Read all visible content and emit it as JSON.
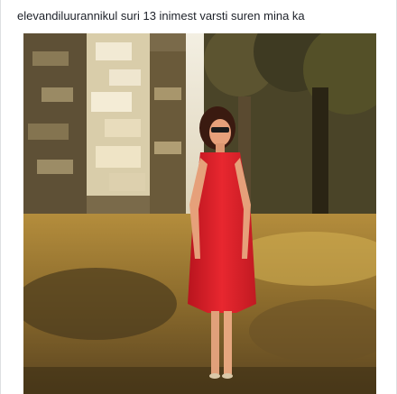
{
  "post": {
    "caption": "elevandiluurannikul suri 13 inimest varsti suren mina ka"
  },
  "photo": {
    "icon": "photo-icon",
    "colors": {
      "stone_light": "#efe6cf",
      "stone_shadow": "#5a4a32",
      "foliage": "#3a3620",
      "grass_sun": "#c9a54a",
      "grass_shadow": "#4a3a1c",
      "dress": "#d8202a",
      "skin": "#e6a07a",
      "hair": "#3a1a10"
    }
  }
}
